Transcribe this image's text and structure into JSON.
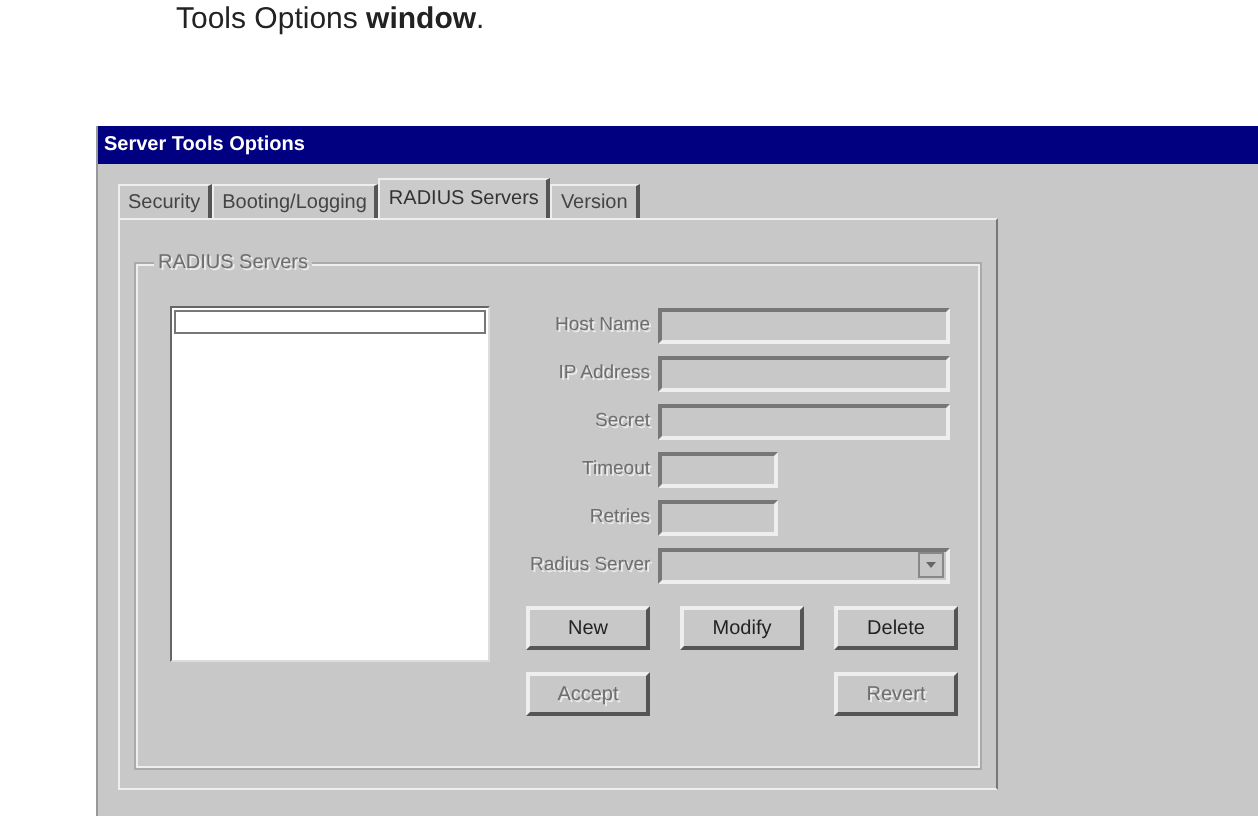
{
  "caption": "Tools Options **window**.",
  "window": {
    "title": "Server Tools Options"
  },
  "tabs": [
    {
      "label": "Security",
      "selected": false
    },
    {
      "label": "Booting/Logging",
      "selected": false
    },
    {
      "label": "RADIUS Servers",
      "selected": true
    },
    {
      "label": "Version",
      "selected": false
    }
  ],
  "group": {
    "title": "RADIUS Servers",
    "disabled": true
  },
  "fields": [
    {
      "label": "Host Name",
      "kind": "text",
      "disabled": true
    },
    {
      "label": "IP Address",
      "kind": "text",
      "disabled": true
    },
    {
      "label": "Secret",
      "kind": "text",
      "disabled": true
    },
    {
      "label": "Timeout",
      "kind": "short",
      "disabled": true
    },
    {
      "label": "Retries",
      "kind": "short",
      "disabled": true
    },
    {
      "label": "Radius Server",
      "kind": "dropdown",
      "disabled": true
    }
  ],
  "buttons": [
    [
      {
        "label": "New",
        "disabled": false
      },
      {
        "label": "Modify",
        "disabled": false
      },
      {
        "label": "Delete",
        "disabled": false
      }
    ],
    [
      {
        "label": "Accept",
        "disabled": true
      },
      {
        "label": "Revert",
        "disabled": true
      }
    ]
  ]
}
